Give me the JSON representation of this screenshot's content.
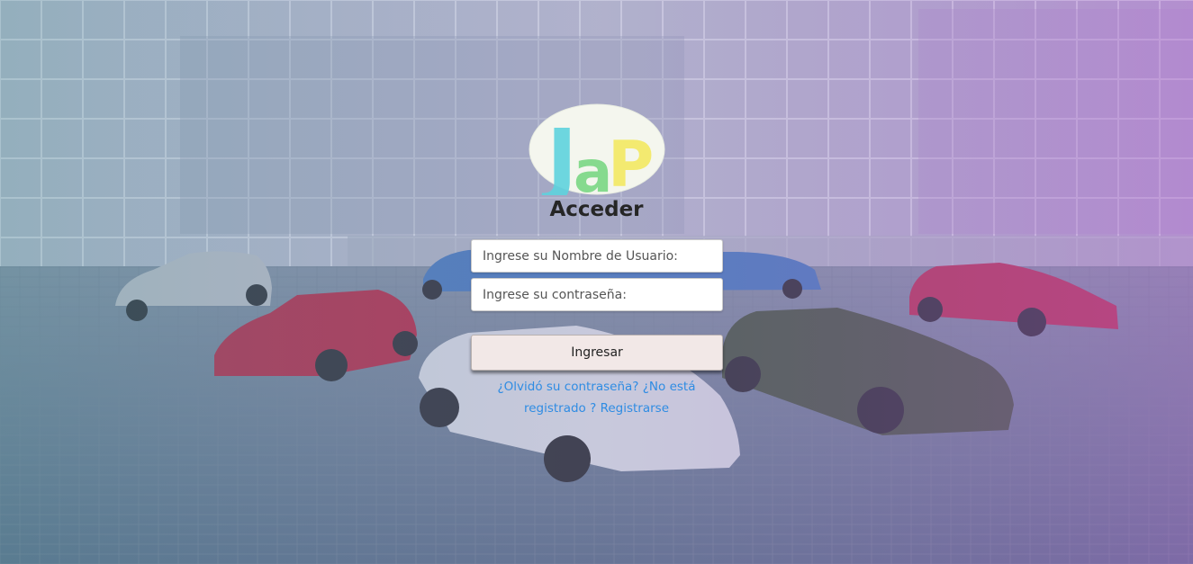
{
  "logo": {
    "letters": [
      "J",
      "a",
      "P"
    ],
    "colors": {
      "background": "#f4f6ee",
      "j": "#5fd3de",
      "a": "#7bd884",
      "p": "#f3ea6a"
    }
  },
  "login": {
    "title": "Acceder",
    "username_placeholder": "Ingrese su Nombre de Usuario:",
    "password_placeholder": "Ingrese su contraseña:",
    "submit_label": "Ingresar",
    "forgot_password_link": "¿Olvidó su contraseña?",
    "not_registered_text": "¿No está registrado ?",
    "register_link": "Registrarse"
  },
  "theme": {
    "overlay_start": "#5a8aa0",
    "overlay_end": "#a06ac8",
    "link_color": "#2f8ce3",
    "button_bg": "#f2e8e7"
  }
}
